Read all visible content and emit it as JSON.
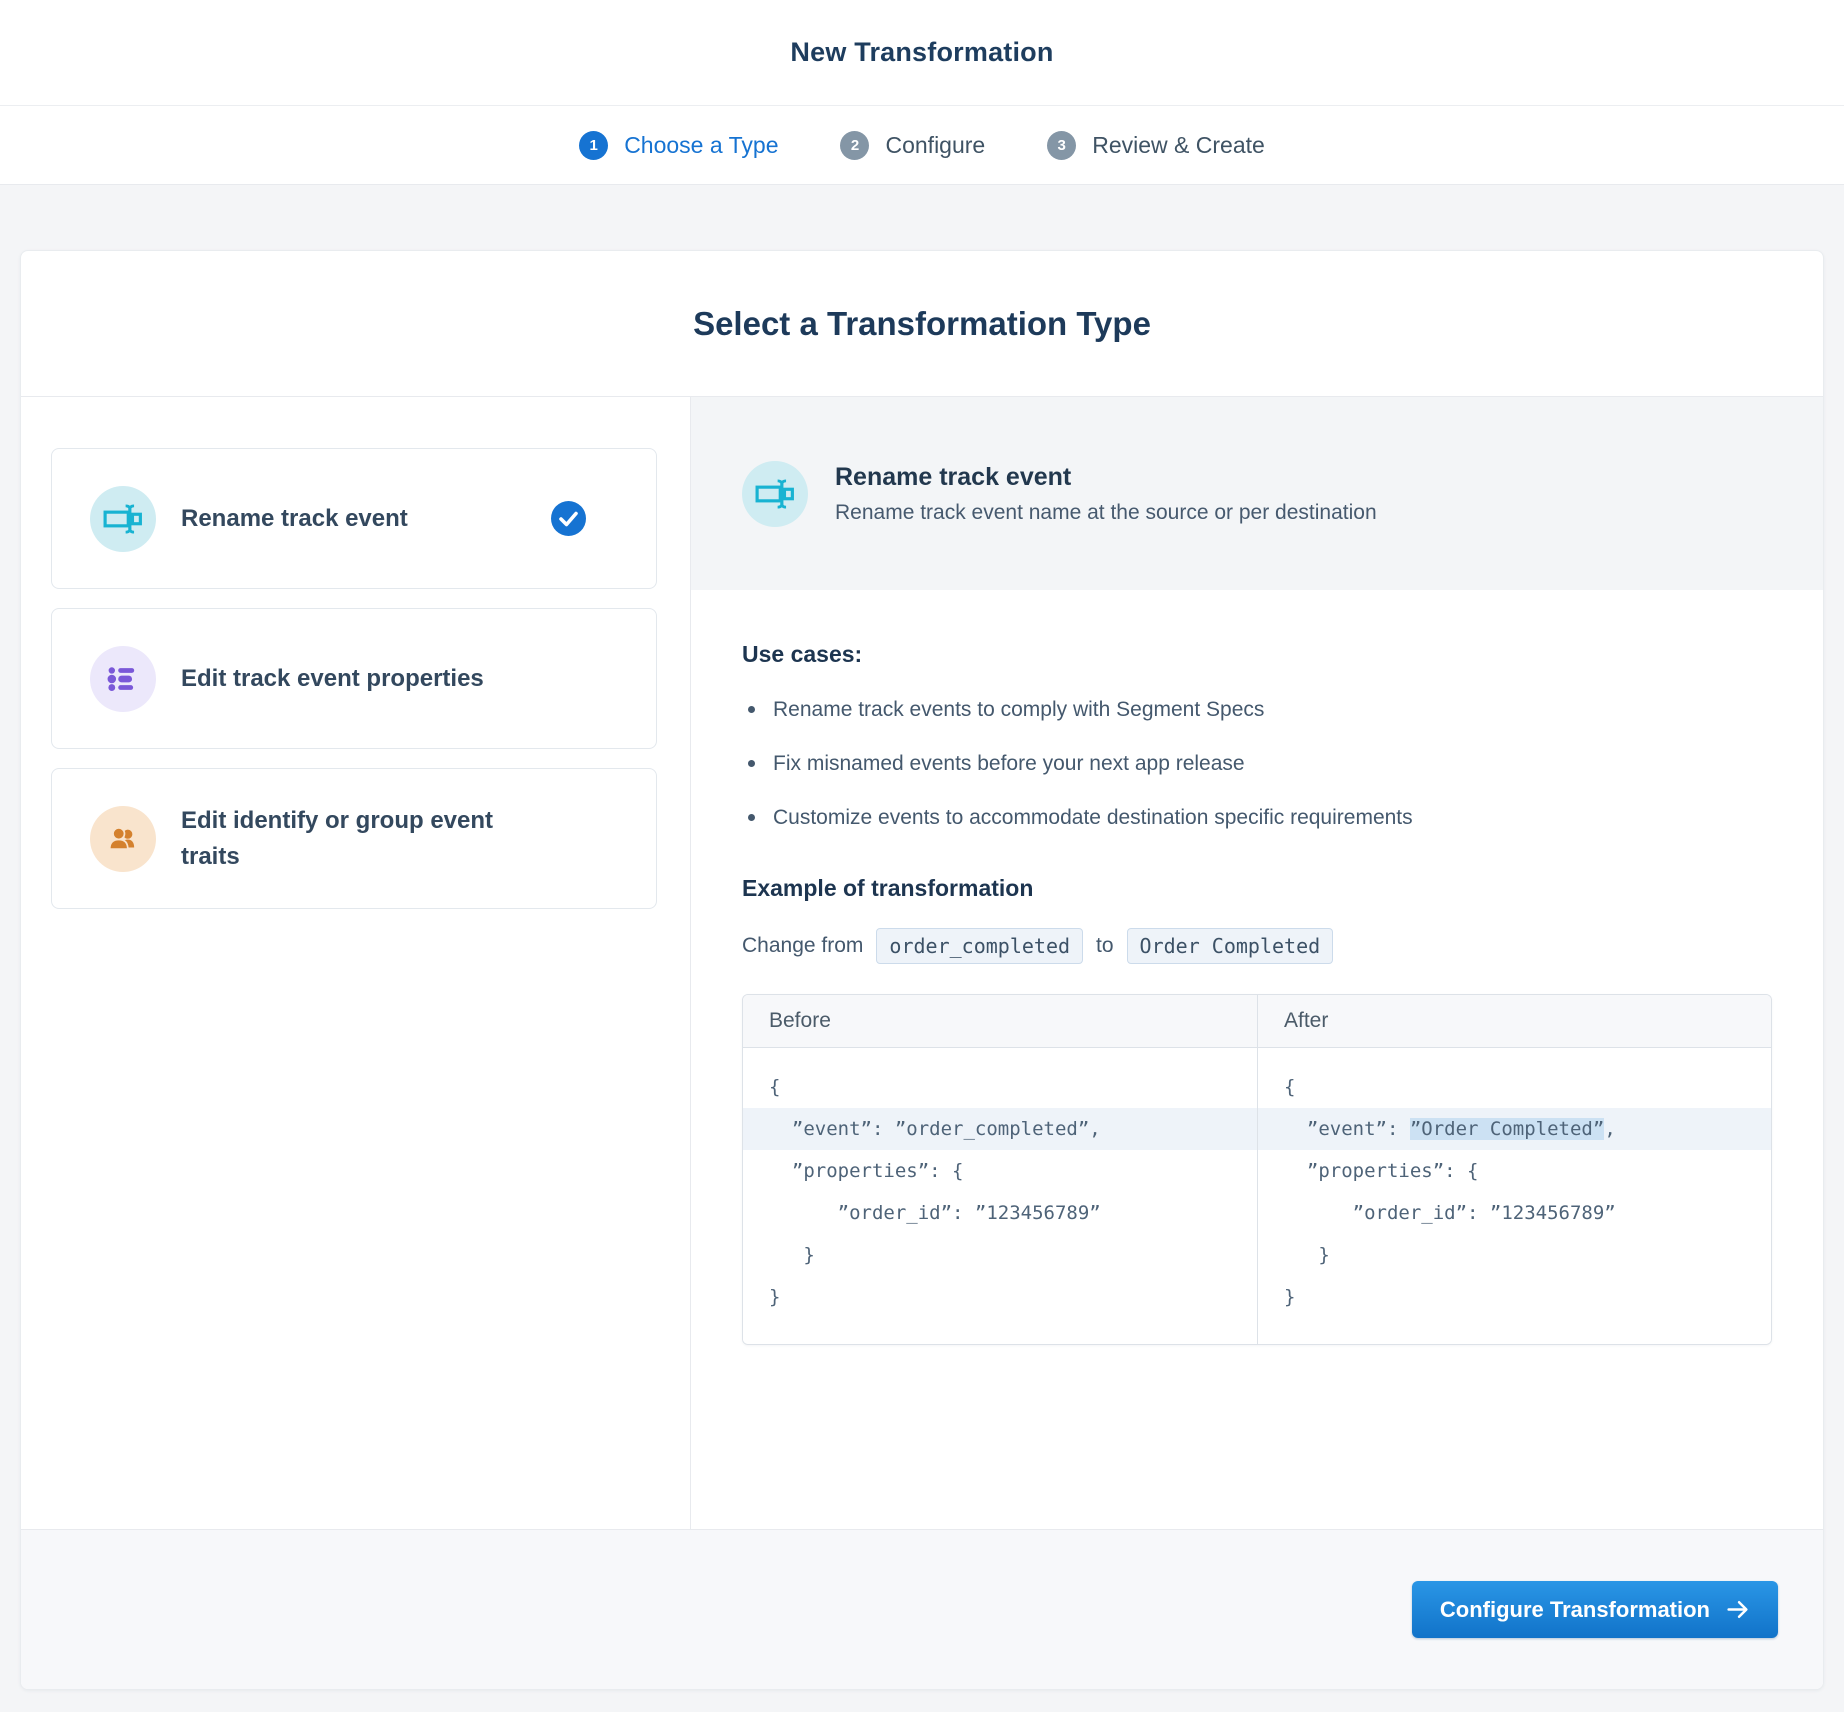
{
  "header": {
    "title": "New Transformation"
  },
  "steps": [
    {
      "number": "1",
      "label": "Choose a Type",
      "state": "active"
    },
    {
      "number": "2",
      "label": "Configure",
      "state": "inactive"
    },
    {
      "number": "3",
      "label": "Review & Create",
      "state": "inactive"
    }
  ],
  "main": {
    "title": "Select a Transformation Type",
    "options": [
      {
        "label": "Rename track event",
        "icon": "rename-icon",
        "selected": true
      },
      {
        "label": "Edit track event properties",
        "icon": "list-icon",
        "selected": false
      },
      {
        "label": "Edit identify or group event traits",
        "icon": "people-icon",
        "selected": false
      }
    ],
    "detail": {
      "title": "Rename track event",
      "description": "Rename track event name at the source or per destination",
      "use_cases_heading": "Use cases:",
      "use_cases": [
        "Rename track events to comply with Segment Specs",
        "Fix misnamed events before your next app release",
        "Customize events to accommodate destination specific requirements"
      ],
      "example_heading": "Example of transformation",
      "change_from_label": "Change from",
      "change_from_code": "order_completed",
      "change_to_label": "to",
      "change_to_code": "Order Completed",
      "comparison": {
        "before_header": "Before",
        "after_header": "After",
        "before_lines": [
          "{",
          "  ”event”: ”order_completed”,",
          "  ”properties”: {",
          "      ”order_id”: ”123456789”",
          "   }",
          "}"
        ],
        "after_lines": [
          "{",
          "  ”properties”: {",
          "      ”order_id”: ”123456789”",
          "   }",
          "}"
        ],
        "after_event_line": {
          "prefix": "  ”event”: ",
          "highlight": "”Order Completed”",
          "suffix": ","
        }
      }
    }
  },
  "footer": {
    "configure_button_label": "Configure Transformation"
  },
  "colors": {
    "accent_blue": "#1673d2",
    "inactive_step_gray": "#8496a6",
    "teal_icon": "#18b3d2",
    "teal_icon_bg": "#cfecf2",
    "purple_icon": "#7a58d8",
    "purple_icon_bg": "#ece8fb",
    "orange_icon": "#d4812e",
    "orange_icon_bg": "#f9e4cd",
    "row_highlight": "#eef3f9",
    "word_highlight": "#cce1f3",
    "button_gradient_top": "#2a96e6",
    "button_gradient_bottom": "#1173c9",
    "page_background": "#f4f5f7"
  }
}
